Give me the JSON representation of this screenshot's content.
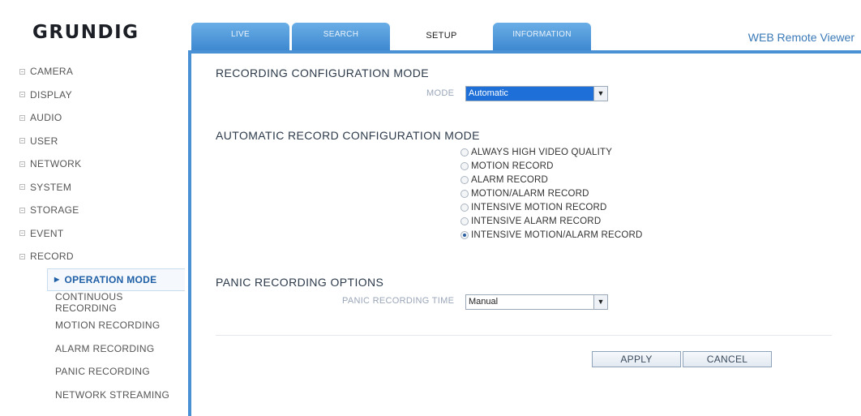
{
  "header": {
    "logo": "GRUNDIG",
    "right_title": "WEB Remote Viewer",
    "tabs": [
      {
        "label": "LIVE",
        "active": false
      },
      {
        "label": "SEARCH",
        "active": false
      },
      {
        "label": "SETUP",
        "active": true
      },
      {
        "label": "INFORMATION",
        "active": false
      }
    ]
  },
  "sidebar": {
    "items": [
      {
        "label": "CAMERA"
      },
      {
        "label": "DISPLAY"
      },
      {
        "label": "AUDIO"
      },
      {
        "label": "USER"
      },
      {
        "label": "NETWORK"
      },
      {
        "label": "SYSTEM"
      },
      {
        "label": "STORAGE"
      },
      {
        "label": "EVENT"
      },
      {
        "label": "RECORD"
      }
    ],
    "subitems": [
      {
        "label": "OPERATION MODE",
        "active": true
      },
      {
        "label": "CONTINUOUS RECORDING"
      },
      {
        "label": "MOTION RECORDING"
      },
      {
        "label": "ALARM RECORDING"
      },
      {
        "label": "PANIC RECORDING"
      },
      {
        "label": "NETWORK STREAMING"
      }
    ]
  },
  "main": {
    "recording_mode": {
      "title": "RECORDING CONFIGURATION MODE",
      "mode_label": "MODE",
      "mode_value": "Automatic"
    },
    "auto_mode": {
      "title": "AUTOMATIC RECORD CONFIGURATION MODE",
      "options": [
        {
          "label": "ALWAYS HIGH VIDEO QUALITY",
          "selected": false
        },
        {
          "label": "MOTION RECORD",
          "selected": false
        },
        {
          "label": "ALARM RECORD",
          "selected": false
        },
        {
          "label": "MOTION/ALARM RECORD",
          "selected": false
        },
        {
          "label": "INTENSIVE MOTION RECORD",
          "selected": false
        },
        {
          "label": "INTENSIVE ALARM RECORD",
          "selected": false
        },
        {
          "label": "INTENSIVE MOTION/ALARM RECORD",
          "selected": true
        }
      ]
    },
    "panic": {
      "title": "PANIC RECORDING OPTIONS",
      "time_label": "PANIC RECORDING TIME",
      "time_value": "Manual"
    },
    "buttons": {
      "apply": "APPLY",
      "cancel": "CANCEL"
    }
  },
  "colors": {
    "tab_blue": "#3b86cf",
    "frame_blue": "#4a90d4",
    "select_highlight": "#1e6fd8",
    "active_link": "#1f5fa6"
  }
}
